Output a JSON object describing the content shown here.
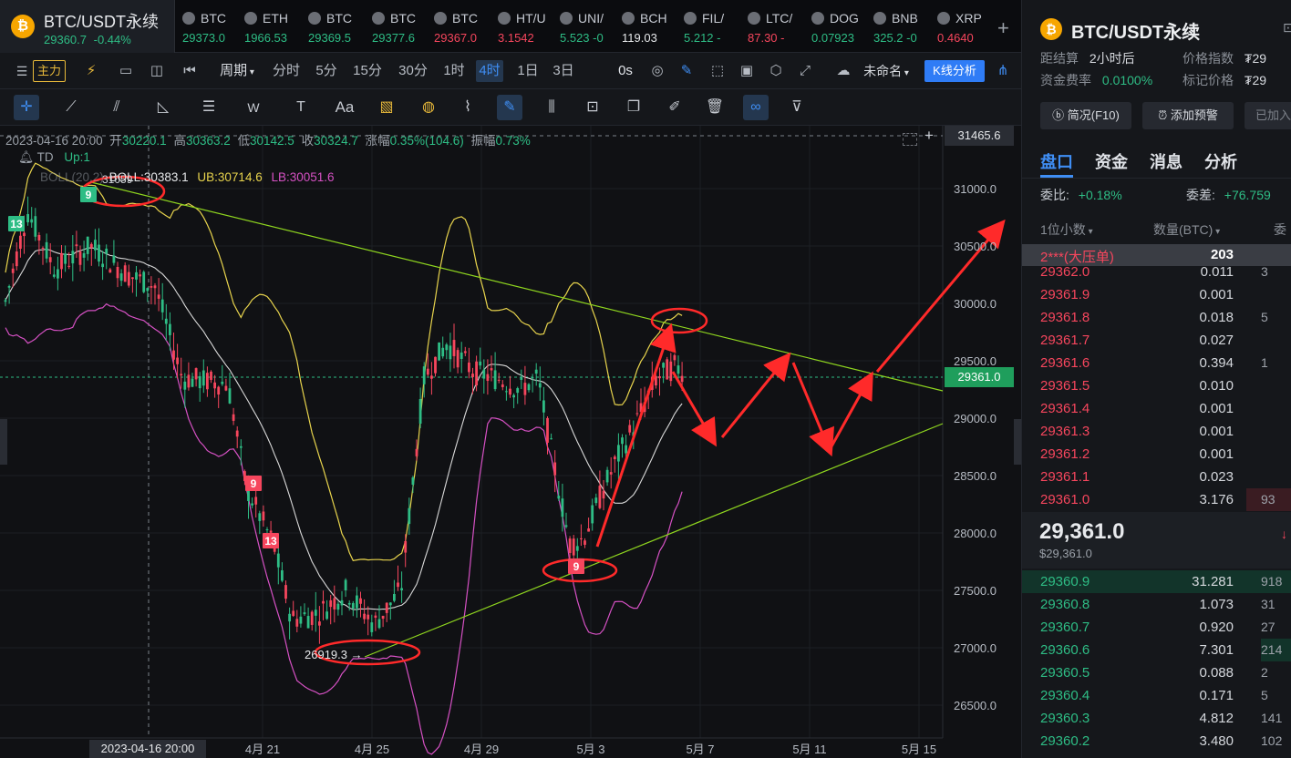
{
  "header": {
    "symbol": "BTC/USDT永续",
    "price": "29360.7",
    "change": "-0.44%"
  },
  "tabs": [
    {
      "name": "BTC",
      "price": "29373.0",
      "dir": "up"
    },
    {
      "name": "ETH",
      "price": "1966.53",
      "dir": "up"
    },
    {
      "name": "BTC",
      "price": "29369.5",
      "dir": "up"
    },
    {
      "name": "BTC",
      "price": "29377.6",
      "dir": "up"
    },
    {
      "name": "BTC",
      "price": "29367.0",
      "dir": "dn"
    },
    {
      "name": "HT/U",
      "price": "3.1542",
      "dir": "dn"
    },
    {
      "name": "UNI/",
      "price": "5.523 -0",
      "dir": "up"
    },
    {
      "name": "BCH",
      "price": "119.03",
      "dir": "wh"
    },
    {
      "name": "FIL/",
      "price": "5.212 -",
      "dir": "up"
    },
    {
      "name": "LTC/",
      "price": "87.30 -",
      "dir": "dn"
    },
    {
      "name": "DOG",
      "price": "0.07923",
      "dir": "up"
    },
    {
      "name": "BNB",
      "price": "325.2 -0",
      "dir": "up"
    },
    {
      "name": "XRP",
      "price": "0.4640",
      "dir": "dn"
    }
  ],
  "toolbar": {
    "indicator_label": "主力",
    "period_label": "周期",
    "intervals": [
      "分时",
      "5分",
      "15分",
      "30分",
      "1时",
      "4时",
      "1日",
      "3日"
    ],
    "active_interval": "4时",
    "countdown": "0s",
    "layout_name": "未命名",
    "analysis_button": "K线分析"
  },
  "drawing_tools": {
    "text_tool": "Aa"
  },
  "chart_info": {
    "datetime": "2023-04-16 20:00",
    "open_label": "开",
    "open": "30220.1",
    "high_label": "高",
    "high": "30363.2",
    "low_label": "低",
    "low": "30142.5",
    "close_label": "收",
    "close": "30324.7",
    "change_label": "涨幅",
    "change": "0.35%(104.6)",
    "amplitude_label": "振幅",
    "amplitude": "0.73%",
    "td_label": "TD",
    "td_up": "Up:1",
    "boll_prefix": "BOLL(20,2)",
    "boll": "BOLL:30383.1",
    "ub": "UB:30714.6",
    "lb": "LB:30051.6",
    "crosshair_price": "31465.6",
    "last_price_tag": "29361.0",
    "high_marker": "31059",
    "low_marker": "26919.3",
    "crosshair_date": "2023-04-16 20:00"
  },
  "chart_data": {
    "type": "candlestick",
    "y_ticks": [
      "31000.0",
      "30500.0",
      "30000.0",
      "29500.0",
      "29000.0",
      "28500.0",
      "28000.0",
      "27500.0",
      "27000.0",
      "26500.0"
    ],
    "x_ticks": [
      "4月 21",
      "4月 25",
      "4月 29",
      "5月 3",
      "5月 7",
      "5月 11",
      "5月 15"
    ],
    "ylim": [
      26300,
      31700
    ],
    "td_labels": [
      {
        "text": "13",
        "color": "#2ebd85"
      },
      {
        "text": "9",
        "color": "#2ebd85"
      },
      {
        "text": "9",
        "color": "#f6465d"
      },
      {
        "text": "13",
        "color": "#f6465d"
      },
      {
        "text": "9",
        "color": "#f6465d"
      }
    ],
    "colors": {
      "up": "#2ebd85",
      "down": "#f6465d",
      "ub": "#e8d44d",
      "mid": "#d9d9d9",
      "lb": "#d651c4",
      "trend": "#8fd61f",
      "annotation": "#ff2a2a"
    }
  },
  "sidebar": {
    "symbol": "BTC/USDT永续",
    "settlement_label": "距结算",
    "settlement_value": "2小时后",
    "index_label": "价格指数",
    "index_value": "₮29",
    "funding_label": "资金费率",
    "funding_value": "0.0100%",
    "mark_label": "标记价格",
    "mark_value": "₮29",
    "btn_overview": "简况(F10)",
    "btn_alert": "添加预警",
    "btn_added": "已加入",
    "tabs": [
      "盘口",
      "资金",
      "消息",
      "分析"
    ],
    "ratio_label": "委比:",
    "ratio_value": "+0.18%",
    "diff_label": "委差:",
    "diff_value": "+76.759",
    "col_decimal": "1位小数",
    "col_qty": "数量(BTC)",
    "col_more": "委",
    "big_order_price": "2***(大压单)",
    "big_order_qty": "203",
    "asks": [
      {
        "p": "29362.0",
        "q": "0.011",
        "t": "3"
      },
      {
        "p": "29361.9",
        "q": "0.001",
        "t": ""
      },
      {
        "p": "29361.8",
        "q": "0.018",
        "t": "5"
      },
      {
        "p": "29361.7",
        "q": "0.027",
        "t": ""
      },
      {
        "p": "29361.6",
        "q": "0.394",
        "t": "1"
      },
      {
        "p": "29361.5",
        "q": "0.010",
        "t": ""
      },
      {
        "p": "29361.4",
        "q": "0.001",
        "t": ""
      },
      {
        "p": "29361.3",
        "q": "0.001",
        "t": ""
      },
      {
        "p": "29361.2",
        "q": "0.001",
        "t": ""
      },
      {
        "p": "29361.1",
        "q": "0.023",
        "t": ""
      },
      {
        "p": "29361.0",
        "q": "3.176",
        "t": "93"
      }
    ],
    "last_price": "29,361.0",
    "last_price_usd": "$29,361.0",
    "bids": [
      {
        "p": "29360.9",
        "q": "31.281",
        "t": "918"
      },
      {
        "p": "29360.8",
        "q": "1.073",
        "t": "31"
      },
      {
        "p": "29360.7",
        "q": "0.920",
        "t": "27"
      },
      {
        "p": "29360.6",
        "q": "7.301",
        "t": "214"
      },
      {
        "p": "29360.5",
        "q": "0.088",
        "t": "2"
      },
      {
        "p": "29360.4",
        "q": "0.171",
        "t": "5"
      },
      {
        "p": "29360.3",
        "q": "4.812",
        "t": "141"
      },
      {
        "p": "29360.2",
        "q": "3.480",
        "t": "102"
      }
    ]
  }
}
